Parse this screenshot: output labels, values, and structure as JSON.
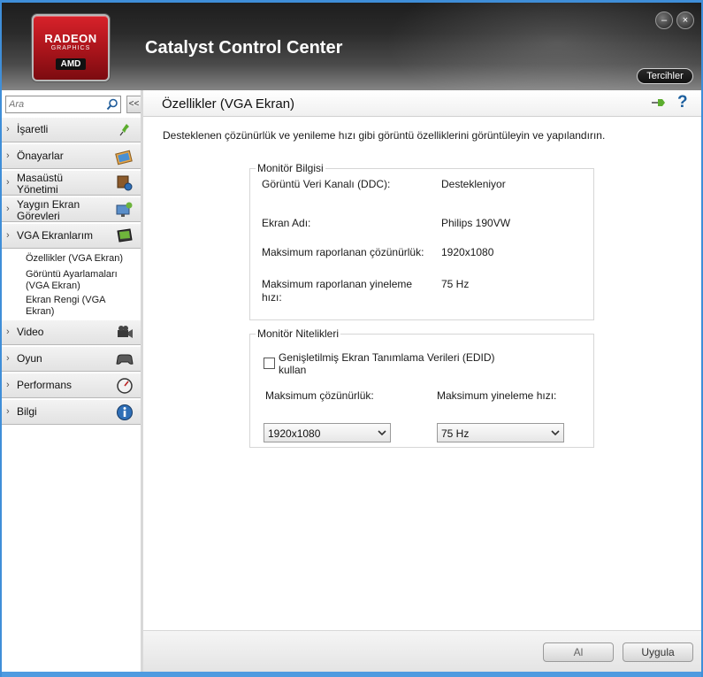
{
  "app": {
    "title": "Catalyst Control Center",
    "logo": {
      "brand": "RADEON",
      "sub": "GRAPHICS",
      "maker": "AMD"
    },
    "preferences_label": "Tercihler",
    "minimize_glyph": "–",
    "close_glyph": "×"
  },
  "sidebar": {
    "search_placeholder": "Ara",
    "collapse_glyph": "<<",
    "items": [
      {
        "label": "İşaretli",
        "icon": "pin-icon"
      },
      {
        "label": "Önayarlar",
        "icon": "presets-icon"
      },
      {
        "label": "Masaüstü Yönetimi",
        "icon": "desktop-management-icon"
      },
      {
        "label": "Yaygın Ekran Görevleri",
        "icon": "display-tasks-icon"
      },
      {
        "label": "VGA Ekranlarım",
        "icon": "vga-monitor-icon"
      },
      {
        "label": "Video",
        "icon": "video-camera-icon"
      },
      {
        "label": "Oyun",
        "icon": "gamepad-icon"
      },
      {
        "label": "Performans",
        "icon": "gauge-icon"
      },
      {
        "label": "Bilgi",
        "icon": "info-icon"
      }
    ],
    "subitems": [
      {
        "label": "Özellikler (VGA Ekran)"
      },
      {
        "label": "Görüntü Ayarlamaları (VGA Ekran)"
      },
      {
        "label": "Ekran Rengi (VGA Ekran)"
      }
    ]
  },
  "main": {
    "title": "Özellikler (VGA Ekran)",
    "description": "Desteklenen çözünürlük ve yenileme hızı gibi görüntü özelliklerini görüntüleyin ve yapılandırın.",
    "monitor_info": {
      "title": "Monitör Bilgisi",
      "rows": [
        {
          "label": "Görüntü Veri Kanalı (DDC):",
          "value": "Destekleniyor"
        },
        {
          "label": "Ekran Adı:",
          "value": "Philips 190VW"
        },
        {
          "label": "Maksimum raporlanan çözünürlük:",
          "value": "1920x1080"
        },
        {
          "label": "Maksimum raporlanan yineleme hızı:",
          "value": "75 Hz"
        }
      ]
    },
    "monitor_attributes": {
      "title": "Monitör Nitelikleri",
      "edid_label": "Genişletilmiş Ekran Tanımlama Verileri (EDID) kullan",
      "edid_checked": false,
      "max_resolution_label": "Maksimum çözünürlük:",
      "max_resolution_value": "1920x1080",
      "max_refresh_label": "Maksimum yineleme hızı:",
      "max_refresh_value": "75 Hz"
    }
  },
  "footer": {
    "discard_label": "Al",
    "apply_label": "Uygula"
  },
  "colors": {
    "accent": "#3f8ed8",
    "brand": "#c8171f"
  }
}
